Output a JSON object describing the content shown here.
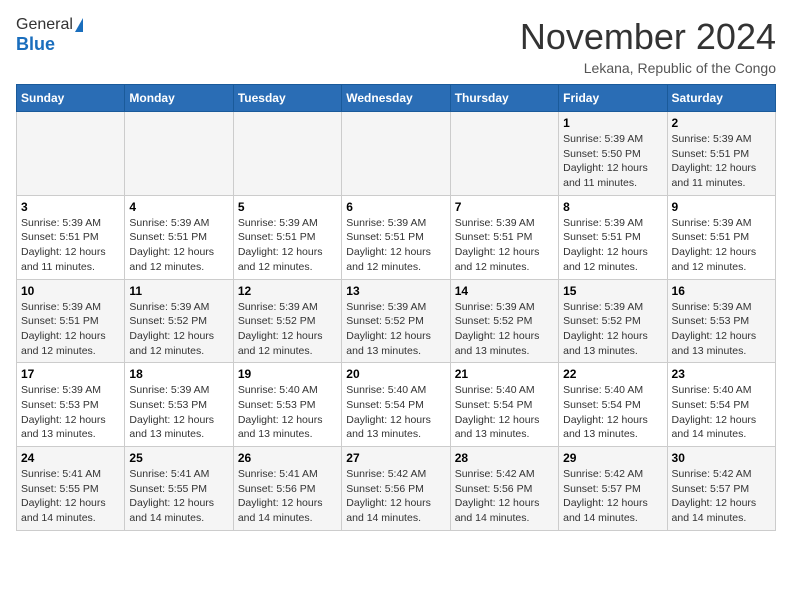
{
  "header": {
    "logo_general": "General",
    "logo_blue": "Blue",
    "month_title": "November 2024",
    "location": "Lekana, Republic of the Congo"
  },
  "days_of_week": [
    "Sunday",
    "Monday",
    "Tuesday",
    "Wednesday",
    "Thursday",
    "Friday",
    "Saturday"
  ],
  "weeks": [
    [
      {
        "day": "",
        "info": ""
      },
      {
        "day": "",
        "info": ""
      },
      {
        "day": "",
        "info": ""
      },
      {
        "day": "",
        "info": ""
      },
      {
        "day": "",
        "info": ""
      },
      {
        "day": "1",
        "info": "Sunrise: 5:39 AM\nSunset: 5:50 PM\nDaylight: 12 hours\nand 11 minutes."
      },
      {
        "day": "2",
        "info": "Sunrise: 5:39 AM\nSunset: 5:51 PM\nDaylight: 12 hours\nand 11 minutes."
      }
    ],
    [
      {
        "day": "3",
        "info": "Sunrise: 5:39 AM\nSunset: 5:51 PM\nDaylight: 12 hours\nand 11 minutes."
      },
      {
        "day": "4",
        "info": "Sunrise: 5:39 AM\nSunset: 5:51 PM\nDaylight: 12 hours\nand 12 minutes."
      },
      {
        "day": "5",
        "info": "Sunrise: 5:39 AM\nSunset: 5:51 PM\nDaylight: 12 hours\nand 12 minutes."
      },
      {
        "day": "6",
        "info": "Sunrise: 5:39 AM\nSunset: 5:51 PM\nDaylight: 12 hours\nand 12 minutes."
      },
      {
        "day": "7",
        "info": "Sunrise: 5:39 AM\nSunset: 5:51 PM\nDaylight: 12 hours\nand 12 minutes."
      },
      {
        "day": "8",
        "info": "Sunrise: 5:39 AM\nSunset: 5:51 PM\nDaylight: 12 hours\nand 12 minutes."
      },
      {
        "day": "9",
        "info": "Sunrise: 5:39 AM\nSunset: 5:51 PM\nDaylight: 12 hours\nand 12 minutes."
      }
    ],
    [
      {
        "day": "10",
        "info": "Sunrise: 5:39 AM\nSunset: 5:51 PM\nDaylight: 12 hours\nand 12 minutes."
      },
      {
        "day": "11",
        "info": "Sunrise: 5:39 AM\nSunset: 5:52 PM\nDaylight: 12 hours\nand 12 minutes."
      },
      {
        "day": "12",
        "info": "Sunrise: 5:39 AM\nSunset: 5:52 PM\nDaylight: 12 hours\nand 12 minutes."
      },
      {
        "day": "13",
        "info": "Sunrise: 5:39 AM\nSunset: 5:52 PM\nDaylight: 12 hours\nand 13 minutes."
      },
      {
        "day": "14",
        "info": "Sunrise: 5:39 AM\nSunset: 5:52 PM\nDaylight: 12 hours\nand 13 minutes."
      },
      {
        "day": "15",
        "info": "Sunrise: 5:39 AM\nSunset: 5:52 PM\nDaylight: 12 hours\nand 13 minutes."
      },
      {
        "day": "16",
        "info": "Sunrise: 5:39 AM\nSunset: 5:53 PM\nDaylight: 12 hours\nand 13 minutes."
      }
    ],
    [
      {
        "day": "17",
        "info": "Sunrise: 5:39 AM\nSunset: 5:53 PM\nDaylight: 12 hours\nand 13 minutes."
      },
      {
        "day": "18",
        "info": "Sunrise: 5:39 AM\nSunset: 5:53 PM\nDaylight: 12 hours\nand 13 minutes."
      },
      {
        "day": "19",
        "info": "Sunrise: 5:40 AM\nSunset: 5:53 PM\nDaylight: 12 hours\nand 13 minutes."
      },
      {
        "day": "20",
        "info": "Sunrise: 5:40 AM\nSunset: 5:54 PM\nDaylight: 12 hours\nand 13 minutes."
      },
      {
        "day": "21",
        "info": "Sunrise: 5:40 AM\nSunset: 5:54 PM\nDaylight: 12 hours\nand 13 minutes."
      },
      {
        "day": "22",
        "info": "Sunrise: 5:40 AM\nSunset: 5:54 PM\nDaylight: 12 hours\nand 13 minutes."
      },
      {
        "day": "23",
        "info": "Sunrise: 5:40 AM\nSunset: 5:54 PM\nDaylight: 12 hours\nand 14 minutes."
      }
    ],
    [
      {
        "day": "24",
        "info": "Sunrise: 5:41 AM\nSunset: 5:55 PM\nDaylight: 12 hours\nand 14 minutes."
      },
      {
        "day": "25",
        "info": "Sunrise: 5:41 AM\nSunset: 5:55 PM\nDaylight: 12 hours\nand 14 minutes."
      },
      {
        "day": "26",
        "info": "Sunrise: 5:41 AM\nSunset: 5:56 PM\nDaylight: 12 hours\nand 14 minutes."
      },
      {
        "day": "27",
        "info": "Sunrise: 5:42 AM\nSunset: 5:56 PM\nDaylight: 12 hours\nand 14 minutes."
      },
      {
        "day": "28",
        "info": "Sunrise: 5:42 AM\nSunset: 5:56 PM\nDaylight: 12 hours\nand 14 minutes."
      },
      {
        "day": "29",
        "info": "Sunrise: 5:42 AM\nSunset: 5:57 PM\nDaylight: 12 hours\nand 14 minutes."
      },
      {
        "day": "30",
        "info": "Sunrise: 5:42 AM\nSunset: 5:57 PM\nDaylight: 12 hours\nand 14 minutes."
      }
    ]
  ]
}
